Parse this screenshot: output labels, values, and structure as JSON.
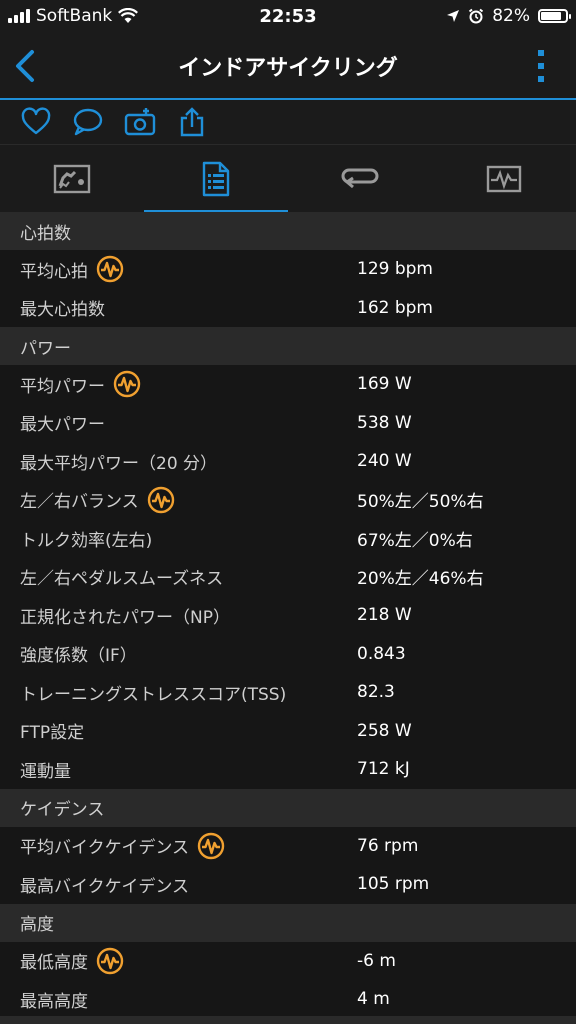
{
  "status": {
    "carrier": "SoftBank",
    "time": "22:53",
    "battery": "82%",
    "battery_level": 0.82
  },
  "nav": {
    "title": "インドアサイクリング"
  },
  "colors": {
    "accent": "#1f8fd8",
    "badge": "#f0a030"
  },
  "icons": {
    "actions": [
      "heart-icon",
      "comment-icon",
      "camera-add-icon",
      "share-icon"
    ],
    "tabs": [
      "overview-tab-icon",
      "stats-tab-icon",
      "laps-tab-icon",
      "chart-tab-icon"
    ]
  },
  "sections": [
    {
      "title": "心拍数",
      "rows": [
        {
          "label": "平均心拍",
          "value": "129 bpm",
          "badge": true
        },
        {
          "label": "最大心拍数",
          "value": "162 bpm",
          "badge": false
        }
      ]
    },
    {
      "title": "パワー",
      "rows": [
        {
          "label": "平均パワー",
          "value": "169 W",
          "badge": true
        },
        {
          "label": "最大パワー",
          "value": "538 W",
          "badge": false
        },
        {
          "label": "最大平均パワー（20 分）",
          "value": "240 W",
          "badge": false
        },
        {
          "label": "左／右バランス",
          "value": "50%左／50%右",
          "badge": true
        },
        {
          "label": "トルク効率(左右)",
          "value": "67%左／0%右",
          "badge": false
        },
        {
          "label": "左／右ペダルスムーズネス",
          "value": "20%左／46%右",
          "badge": false
        },
        {
          "label": "正規化されたパワー（NP）",
          "value": "218 W",
          "badge": false
        },
        {
          "label": "強度係数（IF）",
          "value": "0.843",
          "badge": false
        },
        {
          "label": "トレーニングストレススコア(TSS)",
          "value": "82.3",
          "badge": false
        },
        {
          "label": "FTP設定",
          "value": "258 W",
          "badge": false
        },
        {
          "label": "運動量",
          "value": "712 kJ",
          "badge": false
        }
      ]
    },
    {
      "title": "ケイデンス",
      "rows": [
        {
          "label": "平均バイクケイデンス",
          "value": "76 rpm",
          "badge": true
        },
        {
          "label": "最高バイクケイデンス",
          "value": "105 rpm",
          "badge": false
        }
      ]
    },
    {
      "title": "高度",
      "rows": [
        {
          "label": "最低高度",
          "value": "-6 m",
          "badge": true
        },
        {
          "label": "最高高度",
          "value": "4 m",
          "badge": false
        }
      ]
    }
  ]
}
